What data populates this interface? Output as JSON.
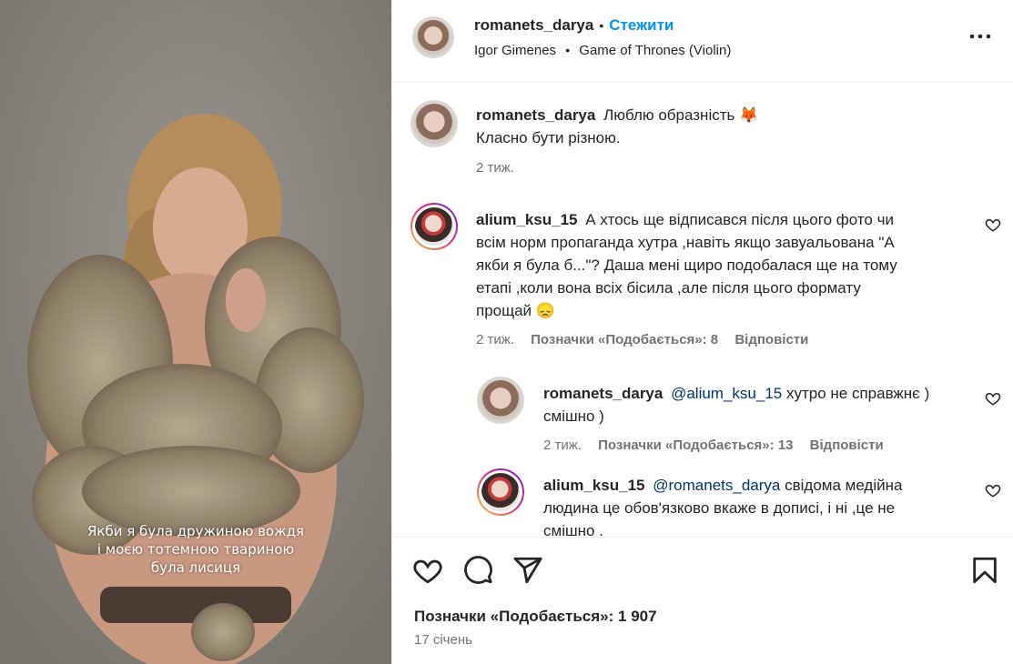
{
  "post": {
    "media_caption_lines": [
      "Якби я була дружиною вождя",
      "і моєю тотемною твариною",
      "була лисиця"
    ]
  },
  "header": {
    "username": "romanets_darya",
    "separator": "•",
    "follow_label": "Стежити",
    "audio_artist": "Igor Gimenes",
    "audio_track": "Game of Thrones (Violin)"
  },
  "caption": {
    "username": "romanets_darya",
    "line1": "Люблю образність",
    "emoji": "🦊",
    "line2": "Класно бути різною.",
    "time": "2 тиж."
  },
  "comments": [
    {
      "username": "alium_ksu_15",
      "text_lines": [
        "А хтось ще відписався після цього фото чи",
        "всім норм пропаганда хутра ,навіть якщо завуальована \"А",
        "якби я була б...\"? Даша мені щиро подобалася ще на тому",
        "етапі ,коли вона всіх бісила ,але після цього формату",
        "прощай 😞"
      ],
      "time": "2 тиж.",
      "likes": "Позначки «Подобається»: 8",
      "reply": "Відповісти"
    }
  ],
  "replies": [
    {
      "username": "romanets_darya",
      "mention": "@alium_ksu_15",
      "text_line1": "хутро не справжнє )",
      "text_line2": "смішно )",
      "time": "2 тиж.",
      "likes": "Позначки «Подобається»: 13",
      "reply": "Відповісти"
    },
    {
      "username": "alium_ksu_15",
      "mention": "@romanets_darya",
      "text_line1": "свідома медійна",
      "text_line2": "людина це обов'язково вкаже в дописі, і ні ,це не",
      "text_line3": "смішно ."
    }
  ],
  "footer": {
    "likes_total": "Позначки «Подобається»: 1 907",
    "date": "17 січень"
  },
  "colors": {
    "link_blue": "#0095f6",
    "mention_blue": "#00376b",
    "secondary_text": "#737373",
    "divider": "#efefef"
  }
}
